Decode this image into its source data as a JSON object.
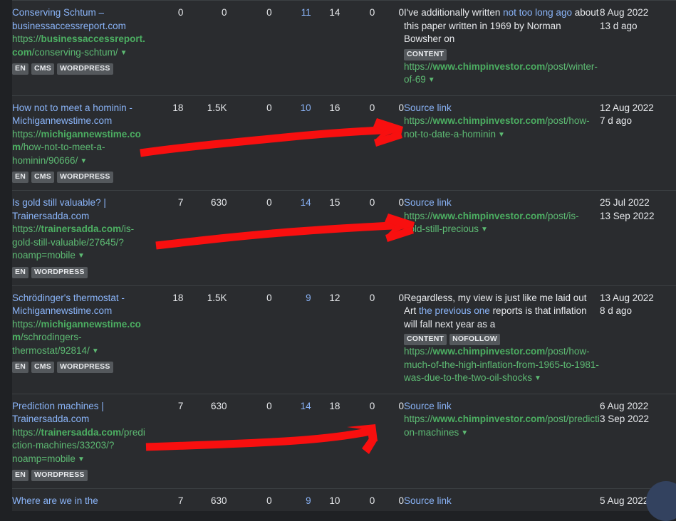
{
  "app": {
    "background_color": "#2a2c2f",
    "accent_link_color": "#8ab4f8",
    "url_color": "#5dba73",
    "annotation_color": "#ff0000"
  },
  "rows": [
    {
      "title": "Conserving Schtum – businessaccessreport.com",
      "url_protocol": "https://",
      "url_domain": "businessaccessreport.c",
      "url_domain_wrap": "om",
      "url_path": "/conserving-schtum/",
      "badges": [
        "EN",
        "CMS",
        "WORDPRESS"
      ],
      "metrics": [
        "0",
        "0",
        "0",
        "11",
        "14",
        "0",
        "0"
      ],
      "metric_links": [
        false,
        false,
        false,
        true,
        false,
        false,
        false
      ],
      "source_label": "",
      "anchor_pre": "I've additionally written ",
      "anchor_link": "not too long ago",
      "anchor_post": " about this paper written in 1969 by Norman Bowsher on",
      "source_badges": [
        "CONTENT"
      ],
      "source_url_protocol": "https://",
      "source_url_domain": "www.chimpinvestor.com",
      "source_url_path": "/post/winter-of-69",
      "date_found": "8 Aug 2022",
      "date_lost": "13 d ago"
    },
    {
      "title": "How not to meet a hominin - Michigannewstime.com",
      "url_protocol": "https://",
      "url_domain": "michigannewstime.com",
      "url_domain_wrap": "",
      "url_path": "/how-not-to-meet-a-hominin/90666/",
      "badges": [
        "EN",
        "CMS",
        "WORDPRESS"
      ],
      "metrics": [
        "18",
        "1.5K",
        "0",
        "10",
        "16",
        "0",
        "0"
      ],
      "metric_links": [
        false,
        false,
        false,
        true,
        false,
        false,
        false
      ],
      "source_label": "Source link",
      "anchor_pre": "",
      "anchor_link": "",
      "anchor_post": "",
      "source_badges": [],
      "source_url_protocol": "https://",
      "source_url_domain": "www.chimpinvestor.com",
      "source_url_path": "/post/how-not-to-date-a-hominin",
      "date_found": "12 Aug 2022",
      "date_lost": "7 d ago"
    },
    {
      "title": "Is gold still valuable? | Trainersadda.com",
      "url_protocol": "https://",
      "url_domain": "trainersadda.com",
      "url_domain_wrap": "",
      "url_path": "/is-gold-still-valuable/27645/?noamp=mobile",
      "badges": [
        "EN",
        "WORDPRESS"
      ],
      "metrics": [
        "7",
        "630",
        "0",
        "14",
        "15",
        "0",
        "0"
      ],
      "metric_links": [
        false,
        false,
        false,
        true,
        false,
        false,
        false
      ],
      "source_label": "Source link",
      "anchor_pre": "",
      "anchor_link": "",
      "anchor_post": "",
      "source_badges": [],
      "source_url_protocol": "https://",
      "source_url_domain": "www.chimpinvestor.com",
      "source_url_path": "/post/is-gold-still-precious",
      "date_found": "25 Jul 2022",
      "date_lost": "13 Sep 2022"
    },
    {
      "title": "Schrödinger's thermostat - Michigannewstime.com",
      "url_protocol": "https://",
      "url_domain": "michigannewstime.com",
      "url_domain_wrap": "",
      "url_path": "/schrodingers-thermostat/92814/",
      "badges": [
        "EN",
        "CMS",
        "WORDPRESS"
      ],
      "metrics": [
        "18",
        "1.5K",
        "0",
        "9",
        "12",
        "0",
        "0"
      ],
      "metric_links": [
        false,
        false,
        false,
        true,
        false,
        false,
        false
      ],
      "source_label": "",
      "anchor_pre": "Regardless, my view is just like me laid out Art ",
      "anchor_link": "the previous one",
      "anchor_post": " reports is that inflation will fall next year as a",
      "source_badges": [
        "CONTENT",
        "NOFOLLOW"
      ],
      "source_url_protocol": "https://",
      "source_url_domain": "www.chimpinvestor.com",
      "source_url_path": "/post/how-much-of-the-high-inflation-from-1965-to-1981-was-due-to-the-two-oil-shocks",
      "date_found": "13 Aug 2022",
      "date_lost": "8 d ago"
    },
    {
      "title": "Prediction machines | Trainersadda.com",
      "url_protocol": "https://",
      "url_domain": "trainersadda.com",
      "url_domain_wrap": "",
      "url_path": "/prediction-machines/33203/?noamp=mobile",
      "badges": [
        "EN",
        "WORDPRESS"
      ],
      "metrics": [
        "7",
        "630",
        "0",
        "14",
        "18",
        "0",
        "0"
      ],
      "metric_links": [
        false,
        false,
        false,
        true,
        false,
        false,
        false
      ],
      "source_label": "Source link",
      "anchor_pre": "",
      "anchor_link": "",
      "anchor_post": "",
      "source_badges": [],
      "source_url_protocol": "https://",
      "source_url_domain": "www.chimpinvestor.com",
      "source_url_path": "/post/prediction-machines",
      "date_found": "6 Aug 2022",
      "date_lost": "3 Sep 2022"
    },
    {
      "title": "Where are we in the",
      "url_protocol": "",
      "url_domain": "",
      "url_domain_wrap": "",
      "url_path": "",
      "badges": [],
      "metrics": [
        "7",
        "630",
        "0",
        "9",
        "10",
        "0",
        "0"
      ],
      "metric_links": [
        false,
        false,
        false,
        true,
        false,
        false,
        false
      ],
      "source_label": "Source link",
      "anchor_pre": "",
      "anchor_link": "",
      "anchor_post": "",
      "source_badges": [],
      "source_url_protocol": "",
      "source_url_domain": "",
      "source_url_path": "",
      "date_found": "5 Aug 2022",
      "date_lost": ""
    }
  ],
  "annotations": {
    "arrow_1": "red-arrow-pointing-right-row-2",
    "arrow_2": "red-arrow-pointing-right-row-3",
    "arrow_3": "red-arrow-pointing-right-row-5"
  },
  "fab": {
    "name": "floating-action-button"
  }
}
